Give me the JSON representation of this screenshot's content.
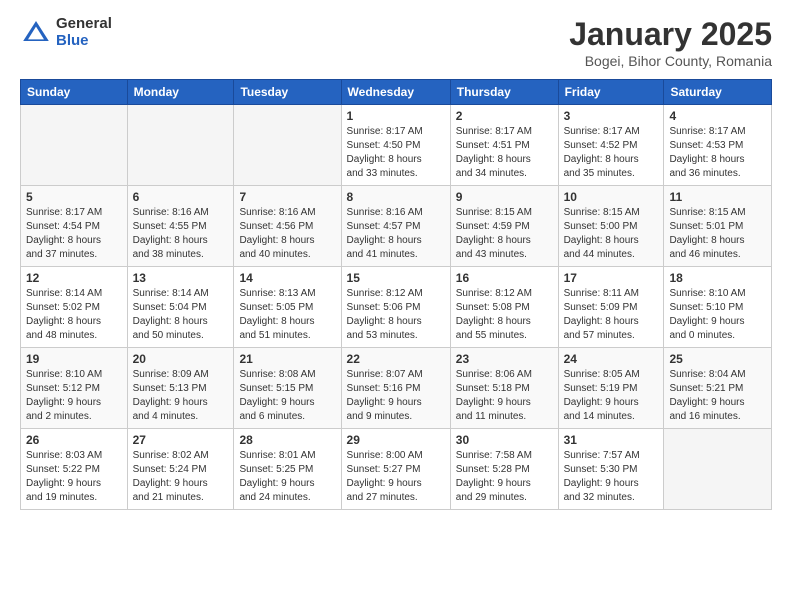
{
  "logo": {
    "general": "General",
    "blue": "Blue"
  },
  "title": {
    "month": "January 2025",
    "location": "Bogei, Bihor County, Romania"
  },
  "weekdays": [
    "Sunday",
    "Monday",
    "Tuesday",
    "Wednesday",
    "Thursday",
    "Friday",
    "Saturday"
  ],
  "weeks": [
    [
      {
        "day": "",
        "info": ""
      },
      {
        "day": "",
        "info": ""
      },
      {
        "day": "",
        "info": ""
      },
      {
        "day": "1",
        "info": "Sunrise: 8:17 AM\nSunset: 4:50 PM\nDaylight: 8 hours\nand 33 minutes."
      },
      {
        "day": "2",
        "info": "Sunrise: 8:17 AM\nSunset: 4:51 PM\nDaylight: 8 hours\nand 34 minutes."
      },
      {
        "day": "3",
        "info": "Sunrise: 8:17 AM\nSunset: 4:52 PM\nDaylight: 8 hours\nand 35 minutes."
      },
      {
        "day": "4",
        "info": "Sunrise: 8:17 AM\nSunset: 4:53 PM\nDaylight: 8 hours\nand 36 minutes."
      }
    ],
    [
      {
        "day": "5",
        "info": "Sunrise: 8:17 AM\nSunset: 4:54 PM\nDaylight: 8 hours\nand 37 minutes."
      },
      {
        "day": "6",
        "info": "Sunrise: 8:16 AM\nSunset: 4:55 PM\nDaylight: 8 hours\nand 38 minutes."
      },
      {
        "day": "7",
        "info": "Sunrise: 8:16 AM\nSunset: 4:56 PM\nDaylight: 8 hours\nand 40 minutes."
      },
      {
        "day": "8",
        "info": "Sunrise: 8:16 AM\nSunset: 4:57 PM\nDaylight: 8 hours\nand 41 minutes."
      },
      {
        "day": "9",
        "info": "Sunrise: 8:15 AM\nSunset: 4:59 PM\nDaylight: 8 hours\nand 43 minutes."
      },
      {
        "day": "10",
        "info": "Sunrise: 8:15 AM\nSunset: 5:00 PM\nDaylight: 8 hours\nand 44 minutes."
      },
      {
        "day": "11",
        "info": "Sunrise: 8:15 AM\nSunset: 5:01 PM\nDaylight: 8 hours\nand 46 minutes."
      }
    ],
    [
      {
        "day": "12",
        "info": "Sunrise: 8:14 AM\nSunset: 5:02 PM\nDaylight: 8 hours\nand 48 minutes."
      },
      {
        "day": "13",
        "info": "Sunrise: 8:14 AM\nSunset: 5:04 PM\nDaylight: 8 hours\nand 50 minutes."
      },
      {
        "day": "14",
        "info": "Sunrise: 8:13 AM\nSunset: 5:05 PM\nDaylight: 8 hours\nand 51 minutes."
      },
      {
        "day": "15",
        "info": "Sunrise: 8:12 AM\nSunset: 5:06 PM\nDaylight: 8 hours\nand 53 minutes."
      },
      {
        "day": "16",
        "info": "Sunrise: 8:12 AM\nSunset: 5:08 PM\nDaylight: 8 hours\nand 55 minutes."
      },
      {
        "day": "17",
        "info": "Sunrise: 8:11 AM\nSunset: 5:09 PM\nDaylight: 8 hours\nand 57 minutes."
      },
      {
        "day": "18",
        "info": "Sunrise: 8:10 AM\nSunset: 5:10 PM\nDaylight: 9 hours\nand 0 minutes."
      }
    ],
    [
      {
        "day": "19",
        "info": "Sunrise: 8:10 AM\nSunset: 5:12 PM\nDaylight: 9 hours\nand 2 minutes."
      },
      {
        "day": "20",
        "info": "Sunrise: 8:09 AM\nSunset: 5:13 PM\nDaylight: 9 hours\nand 4 minutes."
      },
      {
        "day": "21",
        "info": "Sunrise: 8:08 AM\nSunset: 5:15 PM\nDaylight: 9 hours\nand 6 minutes."
      },
      {
        "day": "22",
        "info": "Sunrise: 8:07 AM\nSunset: 5:16 PM\nDaylight: 9 hours\nand 9 minutes."
      },
      {
        "day": "23",
        "info": "Sunrise: 8:06 AM\nSunset: 5:18 PM\nDaylight: 9 hours\nand 11 minutes."
      },
      {
        "day": "24",
        "info": "Sunrise: 8:05 AM\nSunset: 5:19 PM\nDaylight: 9 hours\nand 14 minutes."
      },
      {
        "day": "25",
        "info": "Sunrise: 8:04 AM\nSunset: 5:21 PM\nDaylight: 9 hours\nand 16 minutes."
      }
    ],
    [
      {
        "day": "26",
        "info": "Sunrise: 8:03 AM\nSunset: 5:22 PM\nDaylight: 9 hours\nand 19 minutes."
      },
      {
        "day": "27",
        "info": "Sunrise: 8:02 AM\nSunset: 5:24 PM\nDaylight: 9 hours\nand 21 minutes."
      },
      {
        "day": "28",
        "info": "Sunrise: 8:01 AM\nSunset: 5:25 PM\nDaylight: 9 hours\nand 24 minutes."
      },
      {
        "day": "29",
        "info": "Sunrise: 8:00 AM\nSunset: 5:27 PM\nDaylight: 9 hours\nand 27 minutes."
      },
      {
        "day": "30",
        "info": "Sunrise: 7:58 AM\nSunset: 5:28 PM\nDaylight: 9 hours\nand 29 minutes."
      },
      {
        "day": "31",
        "info": "Sunrise: 7:57 AM\nSunset: 5:30 PM\nDaylight: 9 hours\nand 32 minutes."
      },
      {
        "day": "",
        "info": ""
      }
    ]
  ]
}
